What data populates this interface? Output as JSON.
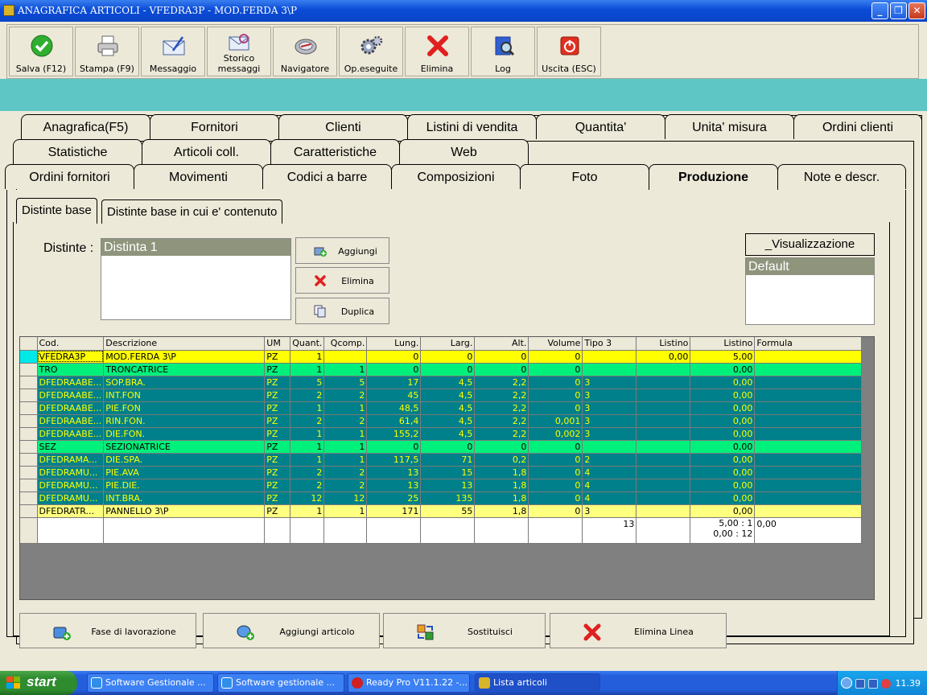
{
  "window": {
    "title": "ANAGRAFICA ARTICOLI - VFEDRA3P - MOD.FERDA 3\\P",
    "min": "_",
    "max": "❐",
    "close": "✕"
  },
  "toolbar": [
    {
      "name": "save-button",
      "label": "Salva (F12)",
      "icon": "check-icon"
    },
    {
      "name": "print-button",
      "label": "Stampa (F9)",
      "icon": "printer-icon"
    },
    {
      "name": "message-button",
      "label": "Messaggio",
      "icon": "envelope-icon"
    },
    {
      "name": "message-history-button",
      "label": "Storico messaggi",
      "icon": "envelope-search-icon"
    },
    {
      "name": "navigator-button",
      "label": "Navigatore",
      "icon": "compass-icon"
    },
    {
      "name": "operations-button",
      "label": "Op.eseguite",
      "icon": "gears-icon"
    },
    {
      "name": "delete-button",
      "label": "Elimina",
      "icon": "red-x-icon"
    },
    {
      "name": "log-button",
      "label": "Log",
      "icon": "book-search-icon"
    },
    {
      "name": "exit-button",
      "label": "Uscita (ESC)",
      "icon": "power-icon"
    }
  ],
  "tabs": {
    "row1": [
      "Anagrafica(F5)",
      "Fornitori",
      "Clienti",
      "Listini di vendita",
      "Quantita'",
      "Unita' misura",
      "Ordini clienti"
    ],
    "row2": [
      "Statistiche",
      "Articoli coll.",
      "Caratteristiche",
      "Web"
    ],
    "row3": [
      "Ordini fornitori",
      "Movimenti",
      "Codici a barre",
      "Composizioni",
      "Foto",
      "Produzione",
      "Note e descr."
    ],
    "active": "Produzione"
  },
  "subtabs": [
    "Distinte base",
    "Distinte base in cui e' contenuto"
  ],
  "distinte": {
    "label": "Distinte :",
    "items": [
      "Distinta 1"
    ],
    "buttons": {
      "add": "Aggiungi",
      "delete": "Elimina",
      "duplicate": "Duplica"
    }
  },
  "visualizzazione": {
    "title": "_Visualizzazione",
    "items": [
      "Default"
    ]
  },
  "grid": {
    "columns": [
      "",
      "Cod.",
      "Descrizione",
      "UM",
      "Quant.",
      "Qcomp.",
      "Lung.",
      "Larg.",
      "Alt.",
      "Volume",
      "Tipo 3",
      "Listino",
      "Listino",
      "Formula"
    ],
    "rows": [
      {
        "style": "yellow",
        "cells": [
          "VFEDRA3P",
          "MOD.FERDA 3\\P",
          "PZ",
          "1",
          "",
          "0",
          "0",
          "0",
          "0",
          "",
          "0,00",
          "5,00",
          ""
        ]
      },
      {
        "style": "green",
        "cells": [
          "TRO",
          "TRONCATRICE",
          "PZ",
          "1",
          "1",
          "0",
          "0",
          "0",
          "0",
          "",
          "",
          "0,00",
          ""
        ]
      },
      {
        "style": "teal",
        "cells": [
          "DFEDRAABE...",
          "SOP.BRA.",
          "PZ",
          "5",
          "5",
          "17",
          "4,5",
          "2,2",
          "0",
          "3",
          "",
          "0,00",
          ""
        ]
      },
      {
        "style": "teal",
        "cells": [
          "DFEDRAABE...",
          "INT.FON",
          "PZ",
          "2",
          "2",
          "45",
          "4,5",
          "2,2",
          "0",
          "3",
          "",
          "0,00",
          ""
        ]
      },
      {
        "style": "teal",
        "cells": [
          "DFEDRAABE...",
          "PIE.FON",
          "PZ",
          "1",
          "1",
          "48,5",
          "4,5",
          "2,2",
          "0",
          "3",
          "",
          "0,00",
          ""
        ]
      },
      {
        "style": "teal",
        "cells": [
          "DFEDRAABE...",
          "RIN.FON.",
          "PZ",
          "2",
          "2",
          "61,4",
          "4,5",
          "2,2",
          "0,001",
          "3",
          "",
          "0,00",
          ""
        ]
      },
      {
        "style": "teal",
        "cells": [
          "DFEDRAABE...",
          "DIE.FON.",
          "PZ",
          "1",
          "1",
          "155,2",
          "4,5",
          "2,2",
          "0,002",
          "3",
          "",
          "0,00",
          ""
        ]
      },
      {
        "style": "green",
        "cells": [
          "SEZ",
          "SEZIONATRICE",
          "PZ",
          "1",
          "1",
          "0",
          "0",
          "0",
          "0",
          "",
          "",
          "0,00",
          ""
        ]
      },
      {
        "style": "teal",
        "cells": [
          "DFEDRAMA...",
          "DIE.SPA.",
          "PZ",
          "1",
          "1",
          "117,5",
          "71",
          "0,2",
          "0",
          "2",
          "",
          "0,00",
          ""
        ]
      },
      {
        "style": "teal",
        "cells": [
          "DFEDRAMU...",
          "PIE.AVA",
          "PZ",
          "2",
          "2",
          "13",
          "15",
          "1,8",
          "0",
          "4",
          "",
          "0,00",
          ""
        ]
      },
      {
        "style": "teal",
        "cells": [
          "DFEDRAMU...",
          "PIE.DIE.",
          "PZ",
          "2",
          "2",
          "13",
          "13",
          "1,8",
          "0",
          "4",
          "",
          "0,00",
          ""
        ]
      },
      {
        "style": "teal",
        "cells": [
          "DFEDRAMU...",
          "INT.BRA.",
          "PZ",
          "12",
          "12",
          "25",
          "135",
          "1,8",
          "0",
          "4",
          "",
          "0,00",
          ""
        ]
      },
      {
        "style": "pale",
        "cells": [
          "DFEDRATR...",
          "PANNELLO 3\\P",
          "PZ",
          "1",
          "1",
          "171",
          "55",
          "1,8",
          "0",
          "3",
          "",
          "0,00",
          ""
        ]
      }
    ],
    "totals": {
      "volume": "13",
      "listino_line1": "5,00 : 1",
      "listino_line2": "0,00 : 12",
      "formula": "0,00"
    }
  },
  "bottom_buttons": [
    {
      "name": "add-phase-button",
      "label": "Fase di lavorazione",
      "icon": "add-phase-icon"
    },
    {
      "name": "add-article-button",
      "label": "Aggiungi articolo",
      "icon": "add-article-icon"
    },
    {
      "name": "replace-button",
      "label": "Sostituisci",
      "icon": "replace-icon"
    },
    {
      "name": "delete-line-button",
      "label": "Elimina Linea",
      "icon": "red-x-icon"
    }
  ],
  "taskbar": {
    "start": "start",
    "tasks": [
      {
        "label": "Software Gestionale ...",
        "icon": "ie-icon"
      },
      {
        "label": "Software gestionale ...",
        "icon": "ie-icon"
      },
      {
        "label": "Ready Pro V11.1.22 -...",
        "icon": "strawberry-icon"
      },
      {
        "label": "Lista articoli",
        "icon": "app-icon"
      }
    ],
    "clock": "11.39"
  },
  "colors": {
    "row_yellow": "#ffff00",
    "row_green": "#00f07c",
    "row_teal": "#00808a",
    "row_pale": "#ffff80",
    "titlebar": "#0a4bd6",
    "teal_desktop": "#5fc6c6"
  }
}
